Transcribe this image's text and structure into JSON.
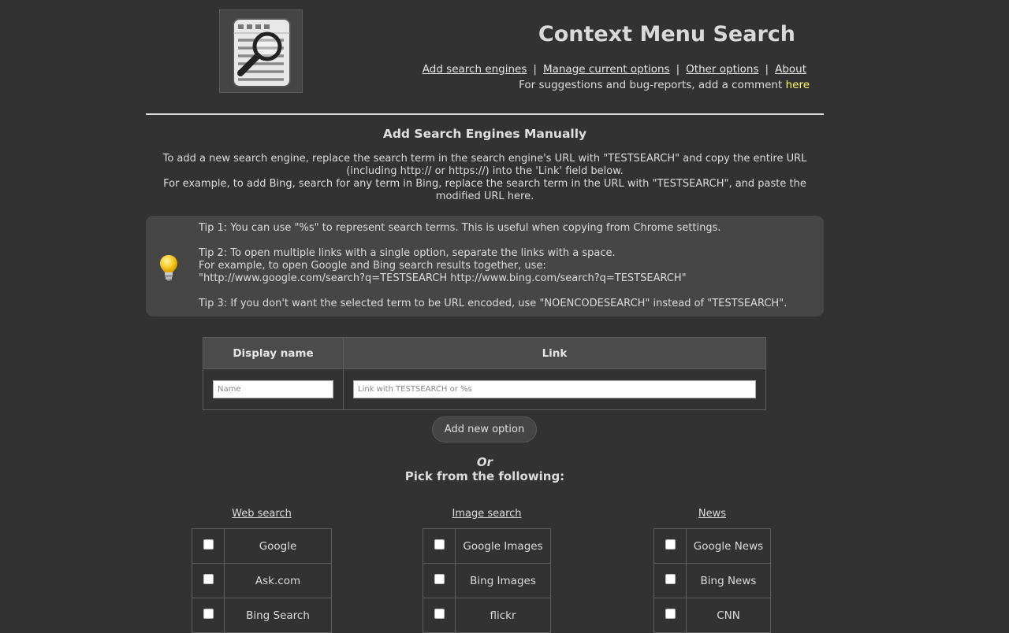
{
  "header": {
    "title": "Context Menu Search",
    "logo_icon": "document-magnifier-icon",
    "nav": [
      {
        "label": "Add search engines"
      },
      {
        "label": "Manage current options"
      },
      {
        "label": "Other options"
      },
      {
        "label": "About"
      }
    ],
    "separator": "|",
    "feedback_text": "For suggestions and bug-reports, add a comment ",
    "feedback_link": "here"
  },
  "manual": {
    "title": "Add Search Engines Manually",
    "intro_line1": "To add a new search engine, replace the search term in the search engine's URL with \"TESTSEARCH\" and copy the entire URL (including http:// or https://) into the 'Link' field below.",
    "intro_line2": "For example, to add Bing, search for any term in Bing, replace the search term in the URL with \"TESTSEARCH\", and paste the modified URL here.",
    "tips_icon": "lightbulb-icon",
    "tip1": "Tip 1: You can use \"%s\" to represent search terms. This is useful when copying from Chrome settings.",
    "tip2_line1": "Tip 2: To open multiple links with a single option, separate the links with a space.",
    "tip2_line2": "For example, to open Google and Bing search results together, use:",
    "tip2_line3": "\"http://www.google.com/search?q=TESTSEARCH http://www.bing.com/search?q=TESTSEARCH\"",
    "tip3": "Tip 3: If you don't want the selected term to be URL encoded, use \"NOENCODESEARCH\" instead of \"TESTSEARCH\".",
    "table": {
      "col_name": "Display name",
      "col_link": "Link",
      "name_value": "",
      "name_placeholder": "Name",
      "link_value": "",
      "link_placeholder": "Link with TESTSEARCH or %s"
    },
    "add_button": "Add new option"
  },
  "pick": {
    "or": "Or",
    "title": "Pick from the following:",
    "categories": [
      {
        "heading": "Web search",
        "items": [
          {
            "label": "Google",
            "checked": false
          },
          {
            "label": "Ask.com",
            "checked": false
          },
          {
            "label": "Bing Search",
            "checked": false
          }
        ]
      },
      {
        "heading": "Image search",
        "items": [
          {
            "label": "Google Images",
            "checked": false
          },
          {
            "label": "Bing Images",
            "checked": false
          },
          {
            "label": "flickr",
            "checked": false
          }
        ]
      },
      {
        "heading": "News",
        "items": [
          {
            "label": "Google News",
            "checked": false
          },
          {
            "label": "Bing News",
            "checked": false
          },
          {
            "label": "CNN",
            "checked": false
          }
        ]
      }
    ]
  },
  "colors": {
    "background": "#323232",
    "panel": "#464646",
    "text": "#dcdcdc",
    "link_highlight": "#ffff66"
  }
}
